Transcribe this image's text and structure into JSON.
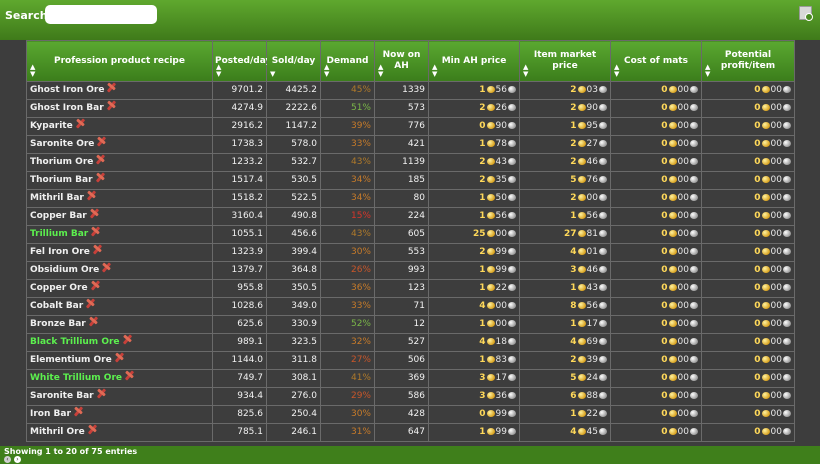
{
  "search": {
    "label": "Search:",
    "value": ""
  },
  "columns": [
    {
      "label": "Profession product recipe"
    },
    {
      "label": "Posted/day"
    },
    {
      "label": "Sold/day"
    },
    {
      "label": "Demand"
    },
    {
      "label": "Now on AH"
    },
    {
      "label": "Min AH price"
    },
    {
      "label": "Item market price"
    },
    {
      "label": "Cost of mats"
    },
    {
      "label": "Potential profit/item"
    }
  ],
  "colors": {
    "demand_green": "#7ab648",
    "demand_orange": "#c77b2a",
    "demand_red": "#d9352a",
    "name_green": "#5cf04e"
  },
  "rows": [
    {
      "name": "Ghost Iron Ore",
      "green": false,
      "posted": "9701.2",
      "sold": "4425.2",
      "demand": "45%",
      "dcolor": "#b07a2a",
      "ah": "1339",
      "min": [
        "1",
        "56"
      ],
      "mkt": [
        "2",
        "03"
      ],
      "cost": [
        "0",
        "00"
      ],
      "profit": [
        "0",
        "00"
      ]
    },
    {
      "name": "Ghost Iron Bar",
      "green": false,
      "posted": "4274.9",
      "sold": "2222.6",
      "demand": "51%",
      "dcolor": "#7ab648",
      "ah": "573",
      "min": [
        "2",
        "26"
      ],
      "mkt": [
        "2",
        "90"
      ],
      "cost": [
        "0",
        "00"
      ],
      "profit": [
        "0",
        "00"
      ]
    },
    {
      "name": "Kyparite",
      "green": false,
      "posted": "2916.2",
      "sold": "1147.2",
      "demand": "39%",
      "dcolor": "#c77b2a",
      "ah": "776",
      "min": [
        "0",
        "90"
      ],
      "mkt": [
        "1",
        "95"
      ],
      "cost": [
        "0",
        "00"
      ],
      "profit": [
        "0",
        "00"
      ]
    },
    {
      "name": "Saronite Ore",
      "green": false,
      "posted": "1738.3",
      "sold": "578.0",
      "demand": "33%",
      "dcolor": "#c77b2a",
      "ah": "421",
      "min": [
        "1",
        "78"
      ],
      "mkt": [
        "2",
        "27"
      ],
      "cost": [
        "0",
        "00"
      ],
      "profit": [
        "0",
        "00"
      ]
    },
    {
      "name": "Thorium Ore",
      "green": false,
      "posted": "1233.2",
      "sold": "532.7",
      "demand": "43%",
      "dcolor": "#b07a2a",
      "ah": "1139",
      "min": [
        "2",
        "43"
      ],
      "mkt": [
        "2",
        "46"
      ],
      "cost": [
        "0",
        "00"
      ],
      "profit": [
        "0",
        "00"
      ]
    },
    {
      "name": "Thorium Bar",
      "green": false,
      "posted": "1517.4",
      "sold": "530.5",
      "demand": "34%",
      "dcolor": "#c77b2a",
      "ah": "185",
      "min": [
        "2",
        "35"
      ],
      "mkt": [
        "5",
        "76"
      ],
      "cost": [
        "0",
        "00"
      ],
      "profit": [
        "0",
        "00"
      ]
    },
    {
      "name": "Mithril Bar",
      "green": false,
      "posted": "1518.2",
      "sold": "522.5",
      "demand": "34%",
      "dcolor": "#c77b2a",
      "ah": "80",
      "min": [
        "1",
        "50"
      ],
      "mkt": [
        "2",
        "00"
      ],
      "cost": [
        "0",
        "00"
      ],
      "profit": [
        "0",
        "00"
      ]
    },
    {
      "name": "Copper Bar",
      "green": false,
      "posted": "3160.4",
      "sold": "490.8",
      "demand": "15%",
      "dcolor": "#d9352a",
      "ah": "224",
      "min": [
        "1",
        "56"
      ],
      "mkt": [
        "1",
        "56"
      ],
      "cost": [
        "0",
        "00"
      ],
      "profit": [
        "0",
        "00"
      ]
    },
    {
      "name": "Trillium Bar",
      "green": true,
      "posted": "1055.1",
      "sold": "456.6",
      "demand": "43%",
      "dcolor": "#b07a2a",
      "ah": "605",
      "min": [
        "25",
        "00"
      ],
      "mkt": [
        "27",
        "81"
      ],
      "cost": [
        "0",
        "00"
      ],
      "profit": [
        "0",
        "00"
      ]
    },
    {
      "name": "Fel Iron Ore",
      "green": false,
      "posted": "1323.9",
      "sold": "399.4",
      "demand": "30%",
      "dcolor": "#c77b2a",
      "ah": "553",
      "min": [
        "2",
        "99"
      ],
      "mkt": [
        "4",
        "01"
      ],
      "cost": [
        "0",
        "00"
      ],
      "profit": [
        "0",
        "00"
      ]
    },
    {
      "name": "Obsidium Ore",
      "green": false,
      "posted": "1379.7",
      "sold": "364.8",
      "demand": "26%",
      "dcolor": "#c9562a",
      "ah": "993",
      "min": [
        "1",
        "99"
      ],
      "mkt": [
        "3",
        "46"
      ],
      "cost": [
        "0",
        "00"
      ],
      "profit": [
        "0",
        "00"
      ]
    },
    {
      "name": "Copper Ore",
      "green": false,
      "posted": "955.8",
      "sold": "350.5",
      "demand": "36%",
      "dcolor": "#c77b2a",
      "ah": "123",
      "min": [
        "1",
        "22"
      ],
      "mkt": [
        "1",
        "43"
      ],
      "cost": [
        "0",
        "00"
      ],
      "profit": [
        "0",
        "00"
      ]
    },
    {
      "name": "Cobalt Bar",
      "green": false,
      "posted": "1028.6",
      "sold": "349.0",
      "demand": "33%",
      "dcolor": "#c77b2a",
      "ah": "71",
      "min": [
        "4",
        "00"
      ],
      "mkt": [
        "8",
        "56"
      ],
      "cost": [
        "0",
        "00"
      ],
      "profit": [
        "0",
        "00"
      ]
    },
    {
      "name": "Bronze Bar",
      "green": false,
      "posted": "625.6",
      "sold": "330.9",
      "demand": "52%",
      "dcolor": "#7ab648",
      "ah": "12",
      "min": [
        "1",
        "00"
      ],
      "mkt": [
        "1",
        "17"
      ],
      "cost": [
        "0",
        "00"
      ],
      "profit": [
        "0",
        "00"
      ]
    },
    {
      "name": "Black Trillium Ore",
      "green": true,
      "posted": "989.1",
      "sold": "323.5",
      "demand": "32%",
      "dcolor": "#c77b2a",
      "ah": "527",
      "min": [
        "4",
        "18"
      ],
      "mkt": [
        "4",
        "69"
      ],
      "cost": [
        "0",
        "00"
      ],
      "profit": [
        "0",
        "00"
      ]
    },
    {
      "name": "Elementium Ore",
      "green": false,
      "posted": "1144.0",
      "sold": "311.8",
      "demand": "27%",
      "dcolor": "#c9562a",
      "ah": "506",
      "min": [
        "1",
        "83"
      ],
      "mkt": [
        "2",
        "39"
      ],
      "cost": [
        "0",
        "00"
      ],
      "profit": [
        "0",
        "00"
      ]
    },
    {
      "name": "White Trillium Ore",
      "green": true,
      "posted": "749.7",
      "sold": "308.1",
      "demand": "41%",
      "dcolor": "#b07a2a",
      "ah": "369",
      "min": [
        "3",
        "17"
      ],
      "mkt": [
        "5",
        "24"
      ],
      "cost": [
        "0",
        "00"
      ],
      "profit": [
        "0",
        "00"
      ]
    },
    {
      "name": "Saronite Bar",
      "green": false,
      "posted": "934.4",
      "sold": "276.0",
      "demand": "29%",
      "dcolor": "#c9562a",
      "ah": "586",
      "min": [
        "3",
        "36"
      ],
      "mkt": [
        "6",
        "88"
      ],
      "cost": [
        "0",
        "00"
      ],
      "profit": [
        "0",
        "00"
      ]
    },
    {
      "name": "Iron Bar",
      "green": false,
      "posted": "825.6",
      "sold": "250.4",
      "demand": "30%",
      "dcolor": "#c77b2a",
      "ah": "428",
      "min": [
        "0",
        "99"
      ],
      "mkt": [
        "1",
        "22"
      ],
      "cost": [
        "0",
        "00"
      ],
      "profit": [
        "0",
        "00"
      ]
    },
    {
      "name": "Mithril Ore",
      "green": false,
      "posted": "785.1",
      "sold": "246.1",
      "demand": "31%",
      "dcolor": "#c77b2a",
      "ah": "647",
      "min": [
        "1",
        "99"
      ],
      "mkt": [
        "4",
        "45"
      ],
      "cost": [
        "0",
        "00"
      ],
      "profit": [
        "0",
        "00"
      ]
    }
  ],
  "footer": {
    "info": "Showing 1 to 20 of 75 entries"
  }
}
